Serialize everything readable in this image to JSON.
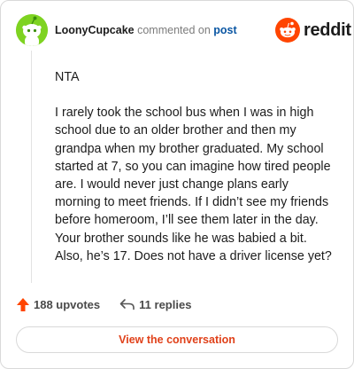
{
  "header": {
    "username": "LoonyCupcake",
    "commented_text": "commented on",
    "post_link": "post",
    "brand": "reddit"
  },
  "comment": {
    "paragraphs": [
      "NTA",
      "I rarely took the school bus when I was in high school due to an older brother and then my grandpa when my brother graduated. My school started at 7, so you can imagine how tired people are. I would never just change plans early morning to meet friends. If I didn’t see my friends before homeroom, I’ll see them later in the day. Your brother sounds like he was babied a bit. Also, he’s 17. Does not have a driver license yet?"
    ]
  },
  "stats": {
    "upvotes": "188 upvotes",
    "replies": "11 replies"
  },
  "cta": {
    "label": "View the conversation"
  },
  "colors": {
    "accent": "#ff4500",
    "avatar_bg": "#7ed321",
    "link": "#0a56a3",
    "cta_text": "#e0411a"
  },
  "icons": {
    "avatar": "snoo-avatar-icon",
    "brand": "reddit-snoo-icon",
    "upvote": "upvote-arrow-icon",
    "reply": "reply-arrow-icon"
  }
}
